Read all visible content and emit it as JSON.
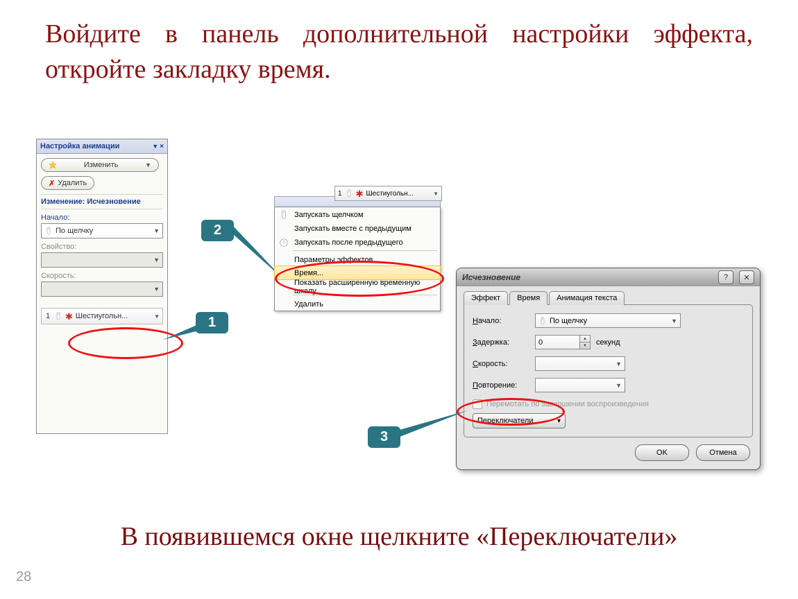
{
  "title_text": "Войдите в панель дополнительной настройки эффекта, откройте закладку время.",
  "footer_text": "В появившемся окне щелкните «Переключатели»",
  "page_number": "28",
  "callouts": {
    "c1": "1",
    "c2": "2",
    "c3": "3"
  },
  "taskpane": {
    "title": "Настройка анимации",
    "btn_change": "Изменить",
    "btn_delete": "Удалить",
    "section": "Изменение: Исчезновение",
    "lbl_start": "Начало:",
    "val_start": "По щелчку",
    "lbl_prop": "Свойство:",
    "lbl_speed": "Скорость:",
    "anim_num": "1",
    "anim_name": "Шестиугольн..."
  },
  "context": {
    "top_num": "1",
    "top_name": "Шестиугольн...",
    "items": [
      "Запускать щелчком",
      "Запускать вместе с предыдущим",
      "Запускать после предыдущего",
      "Параметры эффектов...",
      "Время...",
      "Показать расширенную временную шкалу",
      "Удалить"
    ]
  },
  "dialog": {
    "title": "Исчезновение",
    "tabs": [
      "Эффект",
      "Время",
      "Анимация текста"
    ],
    "lbl_start": "Начало:",
    "lbl_start_u": "Н",
    "val_start": "По щелчку",
    "lbl_delay": "Задержка:",
    "lbl_delay_u": "З",
    "val_delay": "0",
    "delay_unit": "секунд",
    "lbl_speed": "Скорость:",
    "lbl_speed_u": "С",
    "lbl_repeat": "Повторение:",
    "lbl_repeat_u": "П",
    "check_text": "Перемотать по завершении воспроизведения",
    "triggers_btn": "Переключатели",
    "triggers_u": "а",
    "ok": "OK",
    "cancel": "Отмена"
  }
}
